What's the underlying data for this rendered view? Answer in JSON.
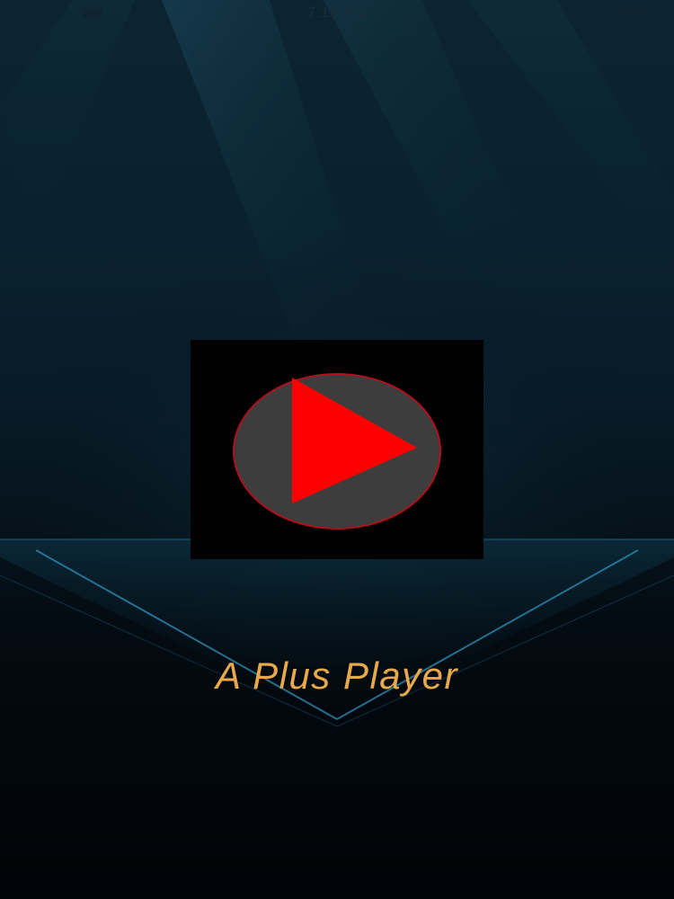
{
  "status_bar": {
    "time": "7:18 PM"
  },
  "app": {
    "title": "A Plus Player"
  },
  "logo": {
    "icon": "play-icon",
    "tile_color": "#000000",
    "circle_fill": "#3d3d3d",
    "circle_stroke": "#b0111a",
    "triangle_color": "#ff0000"
  },
  "colors": {
    "title_text": "#e8a94a",
    "background_top": "#0c2431",
    "background_bottom": "#010407",
    "accent_line": "#2f8fb8"
  }
}
